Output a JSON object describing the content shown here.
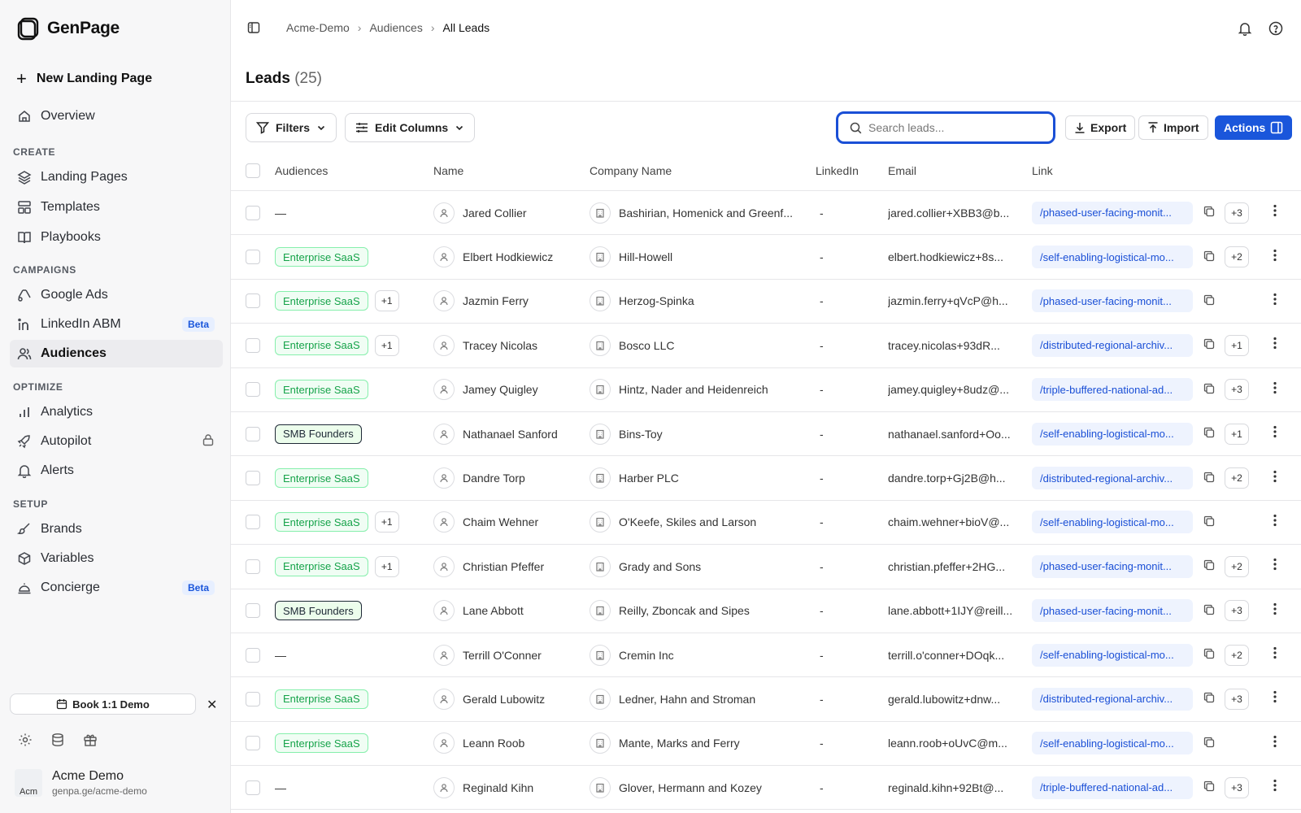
{
  "app": {
    "logo_text": "GenPage"
  },
  "sidebar": {
    "new_landing_page": "New Landing Page",
    "overview": "Overview",
    "sections": {
      "create": "CREATE",
      "campaigns": "CAMPAIGNS",
      "optimize": "OPTIMIZE",
      "setup": "SETUP"
    },
    "items": {
      "landing_pages": "Landing Pages",
      "templates": "Templates",
      "playbooks": "Playbooks",
      "google_ads": "Google Ads",
      "linkedin_abm": "LinkedIn ABM",
      "audiences": "Audiences",
      "analytics": "Analytics",
      "autopilot": "Autopilot",
      "alerts": "Alerts",
      "brands": "Brands",
      "variables": "Variables",
      "concierge": "Concierge"
    },
    "beta_badge": "Beta",
    "book_demo": "Book 1:1 Demo",
    "user": {
      "avatar_text": "Acm",
      "name": "Acme Demo",
      "url": "genpa.ge/acme-demo"
    }
  },
  "breadcrumb": [
    "Acme-Demo",
    "Audiences",
    "All Leads"
  ],
  "page": {
    "title": "Leads",
    "count": "(25)"
  },
  "toolbar": {
    "filters": "Filters",
    "edit_columns": "Edit Columns",
    "search_placeholder": "Search leads...",
    "export": "Export",
    "import": "Import",
    "actions": "Actions"
  },
  "table": {
    "headers": [
      "Audiences",
      "Name",
      "Company Name",
      "LinkedIn",
      "Email",
      "Link"
    ],
    "rows": [
      {
        "audience": "",
        "audience_type": "none",
        "extra": "",
        "name": "Jared Collier",
        "company": "Bashirian, Homenick and Greenf...",
        "linkedin": "-",
        "email": "jared.collier+XBB3@b...",
        "link": "/phased-user-facing-monit...",
        "link_extra": "+3"
      },
      {
        "audience": "Enterprise SaaS",
        "audience_type": "ent",
        "extra": "",
        "name": "Elbert Hodkiewicz",
        "company": "Hill-Howell",
        "linkedin": "-",
        "email": "elbert.hodkiewicz+8s...",
        "link": "/self-enabling-logistical-mo...",
        "link_extra": "+2"
      },
      {
        "audience": "Enterprise SaaS",
        "audience_type": "ent",
        "extra": "+1",
        "name": "Jazmin Ferry",
        "company": "Herzog-Spinka",
        "linkedin": "-",
        "email": "jazmin.ferry+qVcP@h...",
        "link": "/phased-user-facing-monit...",
        "link_extra": ""
      },
      {
        "audience": "Enterprise SaaS",
        "audience_type": "ent",
        "extra": "+1",
        "name": "Tracey Nicolas",
        "company": "Bosco LLC",
        "linkedin": "-",
        "email": "tracey.nicolas+93dR...",
        "link": "/distributed-regional-archiv...",
        "link_extra": "+1"
      },
      {
        "audience": "Enterprise SaaS",
        "audience_type": "ent",
        "extra": "",
        "name": "Jamey Quigley",
        "company": "Hintz, Nader and Heidenreich",
        "linkedin": "-",
        "email": "jamey.quigley+8udz@...",
        "link": "/triple-buffered-national-ad...",
        "link_extra": "+3"
      },
      {
        "audience": "SMB Founders",
        "audience_type": "smb",
        "extra": "",
        "name": "Nathanael Sanford",
        "company": "Bins-Toy",
        "linkedin": "-",
        "email": "nathanael.sanford+Oo...",
        "link": "/self-enabling-logistical-mo...",
        "link_extra": "+1"
      },
      {
        "audience": "Enterprise SaaS",
        "audience_type": "ent",
        "extra": "",
        "name": "Dandre Torp",
        "company": "Harber PLC",
        "linkedin": "-",
        "email": "dandre.torp+Gj2B@h...",
        "link": "/distributed-regional-archiv...",
        "link_extra": "+2"
      },
      {
        "audience": "Enterprise SaaS",
        "audience_type": "ent",
        "extra": "+1",
        "name": "Chaim Wehner",
        "company": "O'Keefe, Skiles and Larson",
        "linkedin": "-",
        "email": "chaim.wehner+bioV@...",
        "link": "/self-enabling-logistical-mo...",
        "link_extra": ""
      },
      {
        "audience": "Enterprise SaaS",
        "audience_type": "ent",
        "extra": "+1",
        "name": "Christian Pfeffer",
        "company": "Grady and Sons",
        "linkedin": "-",
        "email": "christian.pfeffer+2HG...",
        "link": "/phased-user-facing-monit...",
        "link_extra": "+2"
      },
      {
        "audience": "SMB Founders",
        "audience_type": "smb",
        "extra": "",
        "name": "Lane Abbott",
        "company": "Reilly, Zboncak and Sipes",
        "linkedin": "-",
        "email": "lane.abbott+1IJY@reill...",
        "link": "/phased-user-facing-monit...",
        "link_extra": "+3"
      },
      {
        "audience": "",
        "audience_type": "none",
        "extra": "",
        "name": "Terrill O'Conner",
        "company": "Cremin Inc",
        "linkedin": "-",
        "email": "terrill.o'conner+DOqk...",
        "link": "/self-enabling-logistical-mo...",
        "link_extra": "+2"
      },
      {
        "audience": "Enterprise SaaS",
        "audience_type": "ent",
        "extra": "",
        "name": "Gerald Lubowitz",
        "company": "Ledner, Hahn and Stroman",
        "linkedin": "-",
        "email": "gerald.lubowitz+dnw...",
        "link": "/distributed-regional-archiv...",
        "link_extra": "+3"
      },
      {
        "audience": "Enterprise SaaS",
        "audience_type": "ent",
        "extra": "",
        "name": "Leann Roob",
        "company": "Mante, Marks and Ferry",
        "linkedin": "-",
        "email": "leann.roob+oUvC@m...",
        "link": "/self-enabling-logistical-mo...",
        "link_extra": ""
      },
      {
        "audience": "",
        "audience_type": "none",
        "extra": "",
        "name": "Reginald Kihn",
        "company": "Glover, Hermann and Kozey",
        "linkedin": "-",
        "email": "reginald.kihn+92Bt@...",
        "link": "/triple-buffered-national-ad...",
        "link_extra": "+3"
      }
    ],
    "empty_audience": "—"
  }
}
